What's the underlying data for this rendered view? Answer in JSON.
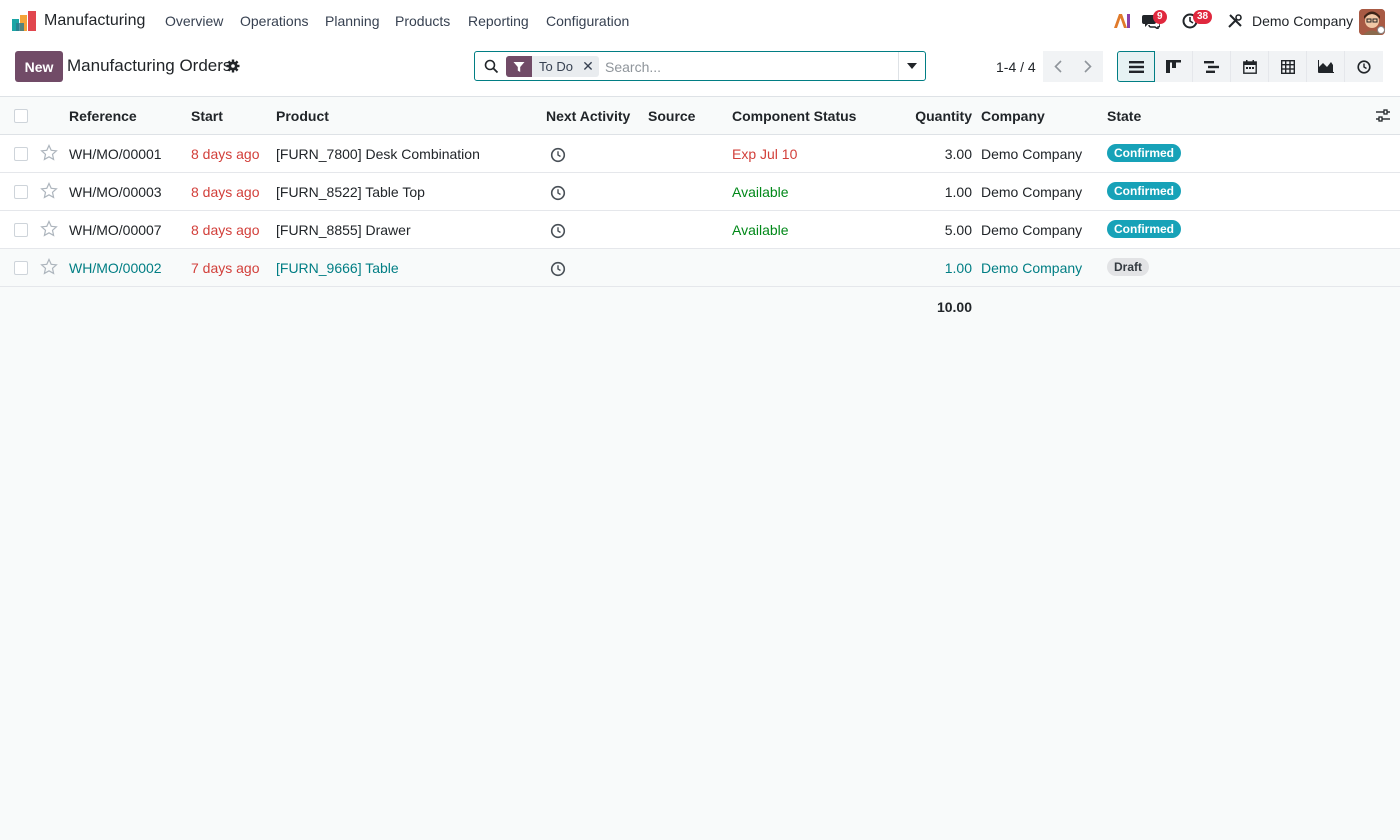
{
  "nav": {
    "app_name": "Manufacturing",
    "menu": [
      "Overview",
      "Operations",
      "Planning",
      "Products",
      "Reporting",
      "Configuration"
    ],
    "messages_count": "9",
    "activities_count": "38",
    "company": "Demo Company"
  },
  "control": {
    "new_label": "New",
    "title": "Manufacturing Orders",
    "facet_label": "To Do",
    "search_placeholder": "Search...",
    "pager": "1-4 / 4"
  },
  "table": {
    "headers": {
      "reference": "Reference",
      "start": "Start",
      "product": "Product",
      "next_activity": "Next Activity",
      "source": "Source",
      "component_status": "Component Status",
      "quantity": "Quantity",
      "company": "Company",
      "state": "State"
    },
    "rows": [
      {
        "reference": "WH/MO/00001",
        "start": "8 days ago",
        "product": "[FURN_7800] Desk Combination",
        "source": "",
        "component_status": "Exp Jul 10",
        "quantity": "3.00",
        "company": "Demo Company",
        "state": "Confirmed"
      },
      {
        "reference": "WH/MO/00003",
        "start": "8 days ago",
        "product": "[FURN_8522] Table Top",
        "source": "",
        "component_status": "Available",
        "quantity": "1.00",
        "company": "Demo Company",
        "state": "Confirmed"
      },
      {
        "reference": "WH/MO/00007",
        "start": "8 days ago",
        "product": "[FURN_8855] Drawer",
        "source": "",
        "component_status": "Available",
        "quantity": "5.00",
        "company": "Demo Company",
        "state": "Confirmed"
      },
      {
        "reference": "WH/MO/00002",
        "start": "7 days ago",
        "product": "[FURN_9666] Table",
        "source": "",
        "component_status": "",
        "quantity": "1.00",
        "company": "Demo Company",
        "state": "Draft"
      }
    ],
    "total_quantity": "10.00"
  },
  "colors": {
    "brand": "#714b67",
    "accent": "#017e84",
    "late": "#d23f3a",
    "available": "#008818",
    "confirmed": "#17a2b8"
  }
}
